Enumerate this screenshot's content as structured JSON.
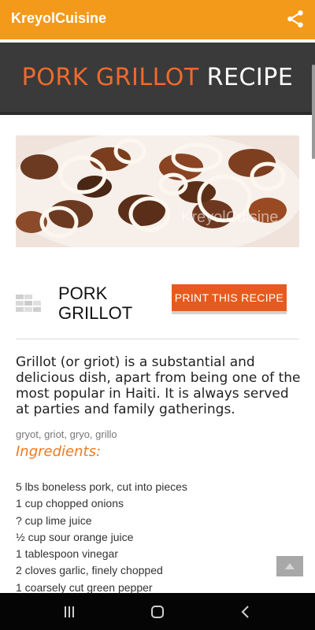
{
  "app_bar": {
    "title": "KreyolCuisine",
    "share_icon": "share-icon"
  },
  "hero": {
    "title_accent": "PORK GRILLOT",
    "title_rest": "RECIPE",
    "accent_color": "#ef6a2c"
  },
  "photo": {
    "watermark": "KreyolCuisine"
  },
  "recipe": {
    "name_line1": "PORK",
    "name_line2": "GRILLOT",
    "print_label": "PRINT THIS RECIPE",
    "intro": "Grillot (or griot) is a substantial and delicious dish, apart from being one of the most popular in Haiti. It is always served at parties and family gatherings.",
    "tags": "gryot, griot, gryo, grillo",
    "ingredients_heading": "Ingredients:",
    "ingredients": [
      "5 lbs boneless pork, cut into pieces",
      "1 cup chopped onions",
      "? cup lime juice",
      "½ cup sour orange juice",
      "1 tablespoon vinegar",
      "2 cloves garlic, finely chopped",
      "1 coarsely cut green pepper"
    ]
  },
  "colors": {
    "app_bar": "#f39a1b",
    "print_button": "#e65a20",
    "hero_band": "#3a3a3a"
  }
}
